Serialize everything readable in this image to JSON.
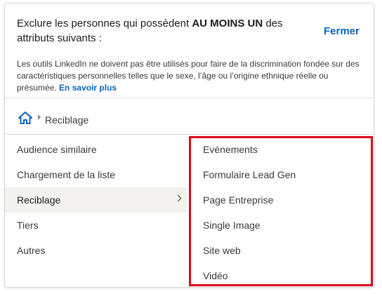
{
  "header": {
    "title_prefix": "Exclure les personnes qui possèdent ",
    "title_bold": "AU MOINS UN",
    "title_suffix": " des attributs suivants :",
    "close_label": "Fermer",
    "disclaimer": "Les outils LinkedIn ne doivent pas être utilisés pour faire de la discrimination fondée sur des caractéristiques personnelles telles que le sexe, l’âge ou l’origine ethnique réelle ou présumée.",
    "learn_more": "En savoir plus"
  },
  "breadcrumb": {
    "icon": "home-icon",
    "current": "Reciblage"
  },
  "left_menu": {
    "items": [
      {
        "label": "Audience similaire"
      },
      {
        "label": "Chargement de la liste"
      },
      {
        "label": "Reciblage"
      },
      {
        "label": "Tiers"
      },
      {
        "label": "Autres"
      }
    ],
    "active_index": 2
  },
  "right_menu": {
    "items": [
      {
        "label": "Evénements"
      },
      {
        "label": "Formulaire Lead Gen"
      },
      {
        "label": "Page Entreprise"
      },
      {
        "label": "Single Image"
      },
      {
        "label": "Site web"
      },
      {
        "label": "Vidéo"
      }
    ]
  },
  "colors": {
    "link": "#0a66c2",
    "highlight": "#e1001a",
    "active_bg": "#f3f2ef"
  }
}
